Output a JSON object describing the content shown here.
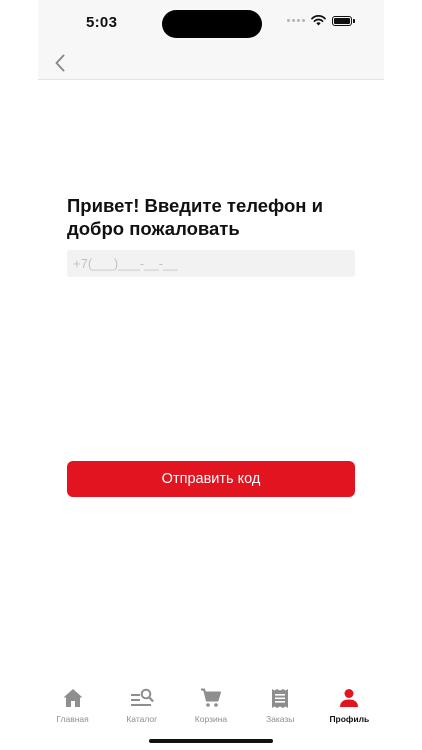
{
  "status_bar": {
    "time": "5:03"
  },
  "nav": {
    "back_icon": "chevron-left-icon"
  },
  "login": {
    "title": "Привет! Введите телефон и добро пожаловать",
    "phone_placeholder": "+7(___)___-__-__",
    "phone_value": "",
    "submit_label": "Отправить код"
  },
  "tab_bar": {
    "items": [
      {
        "label": "Главная",
        "icon": "home-icon",
        "active": false
      },
      {
        "label": "Каталог",
        "icon": "catalog-search-icon",
        "active": false
      },
      {
        "label": "Корзина",
        "icon": "cart-icon",
        "active": false
      },
      {
        "label": "Заказы",
        "icon": "orders-receipt-icon",
        "active": false
      },
      {
        "label": "Профиль",
        "icon": "profile-icon",
        "active": true
      }
    ]
  },
  "colors": {
    "accent": "#e2141f",
    "inactive_tab": "#8e8e8e",
    "input_bg": "#f2f2f2"
  }
}
